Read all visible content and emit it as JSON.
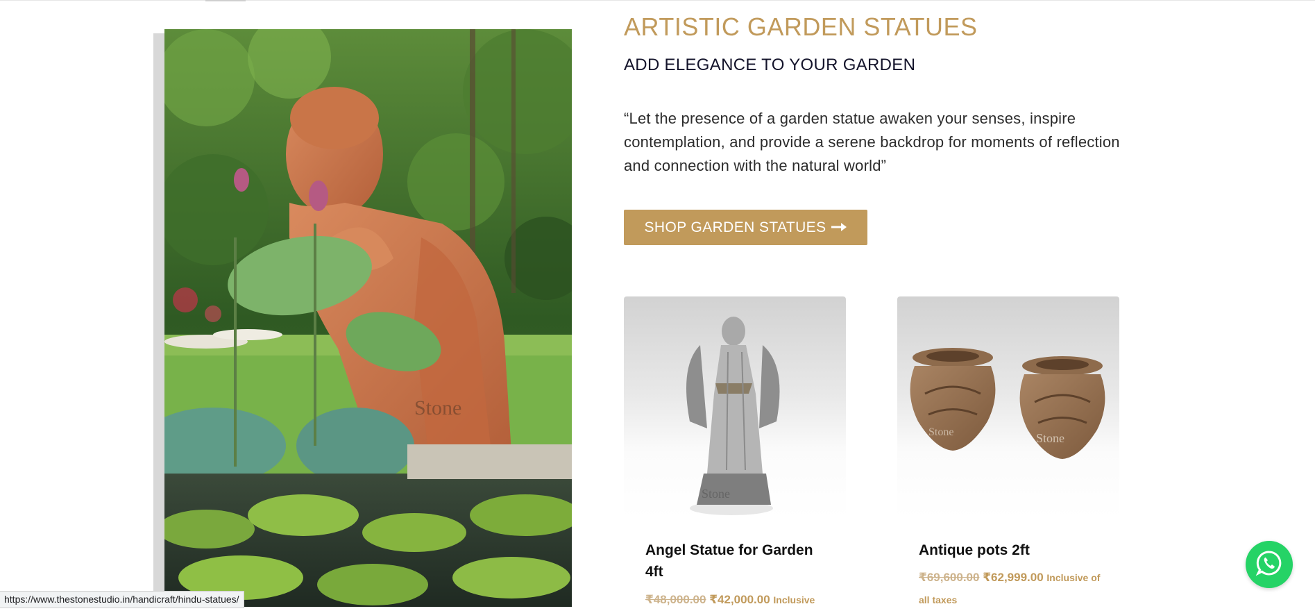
{
  "hero": {
    "image_alt": "Terracotta Buddha garden statue beside lotus pond",
    "watermark": "the Stone"
  },
  "section": {
    "title": "ARTISTIC GARDEN STATUES",
    "subtitle": "ADD ELEGANCE TO YOUR GARDEN",
    "quote": "“Let the presence of a garden statue awaken your senses, inspire contemplation, and provide a serene backdrop for moments of reflection and connection with the natural world”",
    "cta_label": "SHOP GARDEN STATUES",
    "cta_icon": "arrow-right-icon"
  },
  "products": [
    {
      "name": "Angel Statue for Garden 4ft",
      "old_price": "₹48,000.00",
      "new_price": "₹42,000.00",
      "tax_note": "Inclusive",
      "image": "angel-statue"
    },
    {
      "name": "Antique pots 2ft",
      "old_price": "₹69,600.00",
      "new_price": "₹62,999.00",
      "tax_note": "Inclusive of all taxes",
      "image": "antique-pots"
    }
  ],
  "status_bar": {
    "url": "https://www.thestonestudio.in/handicraft/hindu-statues/"
  },
  "chat": {
    "icon": "whatsapp-icon"
  },
  "colors": {
    "accent": "#c19a5b",
    "heading": "#14142b",
    "whatsapp": "#25d366"
  }
}
